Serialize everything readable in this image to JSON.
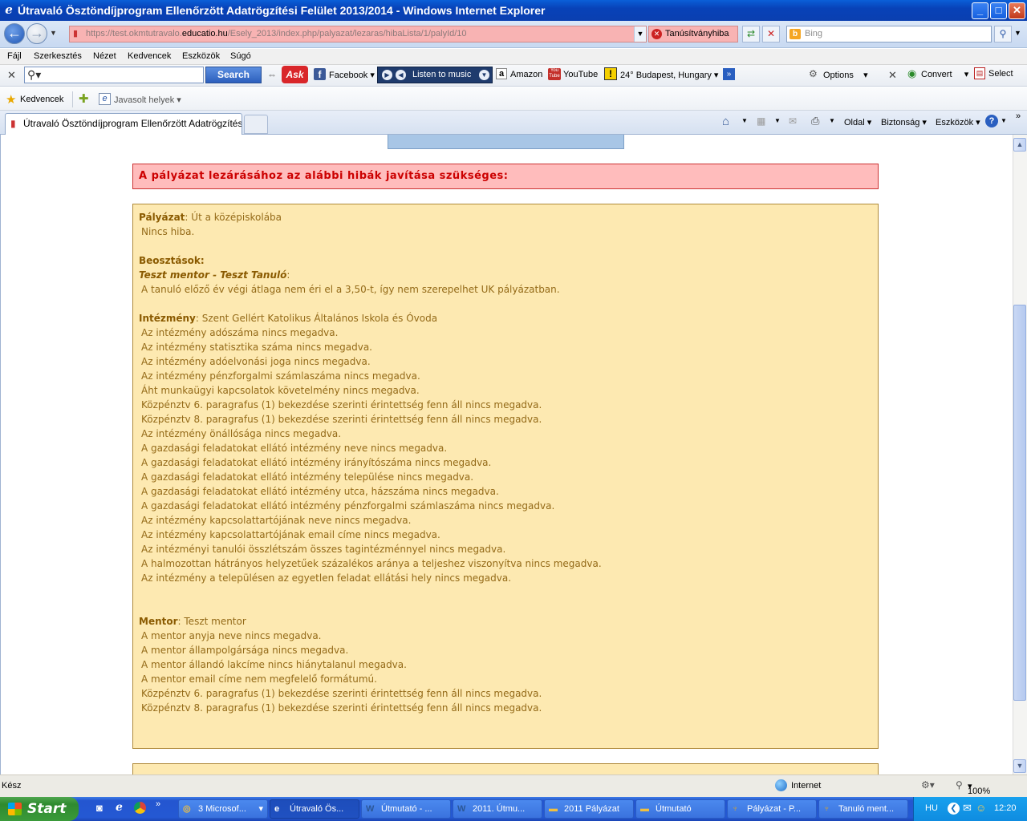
{
  "window": {
    "title": "Útravaló Ösztöndíjprogram Ellenőrzött Adatrögzítési Felület 2013/2014 - Windows Internet Explorer",
    "min": "_",
    "max": "□",
    "close": "✕"
  },
  "address": {
    "prefix": "https://test.okmtutravalo.",
    "domain": "educatio.hu",
    "path": "/Esely_2013/index.php/palyazat/lezaras/hibaLista/1/palyId/10",
    "cert_label": "Tanúsítványhiba",
    "search_placeholder": "Bing"
  },
  "menu": [
    "Fájl",
    "Szerkesztés",
    "Nézet",
    "Kedvencek",
    "Eszközök",
    "Súgó"
  ],
  "toolbar": {
    "search_button": "Search",
    "facebook": "Facebook",
    "music": "Listen to music",
    "amazon": "Amazon",
    "youtube": "YouTube",
    "weather": "24° Budapest, Hungary",
    "options": "Options",
    "convert": "Convert",
    "select": "Select"
  },
  "favorites": {
    "label": "Kedvencek",
    "suggested": "Javasolt helyek"
  },
  "tab": {
    "title": "Útravaló Ösztöndíjprogram Ellenőrzött Adatrögzítési F...",
    "page": "Oldal",
    "security": "Biztonság",
    "tools": "Eszközök"
  },
  "content": {
    "error_header": "A pályázat lezárásához az alábbi hibák javítása szükséges:",
    "palyazat_label": "Pályázat",
    "palyazat_value": ": Út a középiskolába",
    "palyazat_msg": "Nincs hiba.",
    "beosztasok_label": "Beosztások",
    "beosztasok_colon": ":",
    "mentor_student": "Teszt mentor - Teszt Tanuló",
    "mentor_student_colon": ":",
    "beosztas_msg": "A tanuló előző év végi átlaga nem éri el a 3,50-t, így nem szerepelhet UK pályázatban.",
    "intezmeny_label": "Intézmény",
    "intezmeny_value": ": Szent Gellért Katolikus Általános Iskola és Óvoda",
    "intezmeny_errors": [
      "Az intézmény adószáma nincs megadva.",
      "Az intézmény statisztika száma nincs megadva.",
      "Az intézmény adóelvonási joga nincs megadva.",
      "Az intézmény pénzforgalmi számlaszáma nincs megadva.",
      "Áht munkaügyi kapcsolatok követelmény nincs megadva.",
      "Közpénztv 6. paragrafus (1) bekezdése szerinti érintettség fenn áll nincs megadva.",
      "Közpénztv 8. paragrafus (1) bekezdése szerinti érintettség fenn áll nincs megadva.",
      "Az intézmény önállósága nincs megadva.",
      "A gazdasági feladatokat ellátó intézmény neve nincs megadva.",
      "A gazdasági feladatokat ellátó intézmény irányítószáma nincs megadva.",
      "A gazdasági feladatokat ellátó intézmény települése nincs megadva.",
      "A gazdasági feladatokat ellátó intézmény utca, házszáma nincs megadva.",
      "A gazdasági feladatokat ellátó intézmény pénzforgalmi számlaszáma nincs megadva.",
      "Az intézmény kapcsolattartójának neve nincs megadva.",
      "Az intézmény kapcsolattartójának email címe nincs megadva.",
      "Az intézményi tanulói összlétszám összes tagintézménnyel nincs megadva.",
      "A halmozottan hátrányos helyzetűek százalékos aránya a teljeshez viszonyítva nincs megadva.",
      "Az intézmény a településen az egyetlen feladat ellátási hely nincs megadva."
    ],
    "mentor_label": "Mentor",
    "mentor_value": ": Teszt mentor",
    "mentor_errors": [
      "A mentor anyja neve nincs megadva.",
      "A mentor állampolgársága nincs megadva.",
      "A mentor állandó lakcíme nincs hiánytalanul megadva.",
      "A mentor email címe nem megfelelő formátumú.",
      "Közpénztv 6. paragrafus (1) bekezdése szerinti érintettség fenn áll nincs megadva.",
      "Közpénztv 8. paragrafus (1) bekezdése szerinti érintettség fenn áll nincs megadva."
    ]
  },
  "status": {
    "left": "Kész",
    "zone": "Internet",
    "zoom": "100%"
  },
  "taskbar": {
    "start": "Start",
    "tasks": [
      "3 Microsof...",
      "Útravaló Ös...",
      "Útmutató - ...",
      "2011. Útmu...",
      "2011 Pályázat",
      "Útmutató",
      "Pályázat - P...",
      "Tanuló ment..."
    ],
    "lang": "HU",
    "clock": "12:20"
  }
}
